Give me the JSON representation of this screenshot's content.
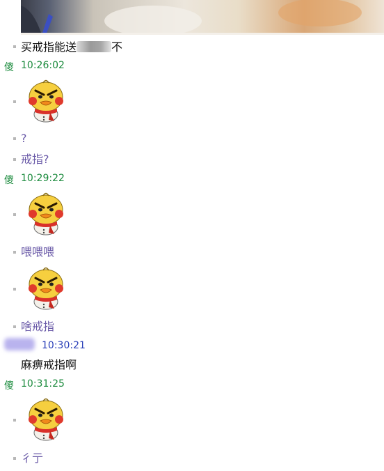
{
  "messages": {
    "m1": {
      "before": "买戒指能送",
      "after": "不"
    },
    "h1": {
      "name": "傻",
      "time": "10:26:02"
    },
    "m3": "?",
    "m4": "戒指?",
    "h2": {
      "name": "傻",
      "time": "10:29:22"
    },
    "m6": "喂喂喂",
    "m8": "啥戒指",
    "h3": {
      "time": "10:30:21"
    },
    "m9": "麻痹戒指啊",
    "h4": {
      "name": "傻",
      "time": "10:31:25"
    },
    "m11": "彳亍"
  },
  "colors": {
    "timestamp_green": "#1a8a3c",
    "timestamp_blue": "#2a3fb8",
    "my_text": "#6a5aa8",
    "their_text": "#111111"
  },
  "icons": {
    "sticker": "angry-duck-sticker-icon"
  }
}
